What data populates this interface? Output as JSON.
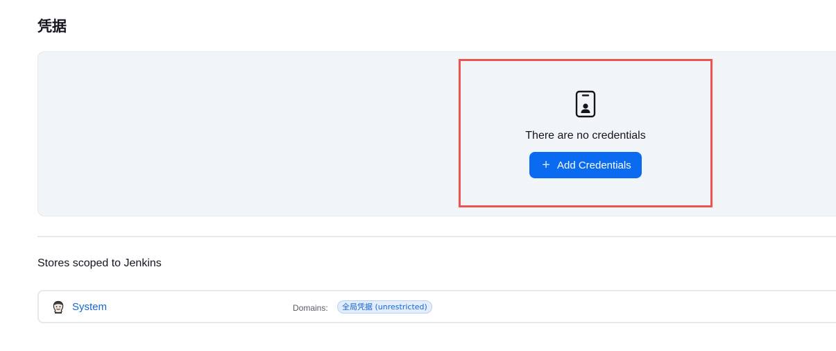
{
  "page": {
    "title": "凭据"
  },
  "empty_state": {
    "icon": "credential-card-icon",
    "message": "There are no credentials",
    "add_button": {
      "icon": "plus-icon",
      "label": "Add Credentials"
    }
  },
  "highlight": {
    "color": "#ef5350"
  },
  "stores": {
    "heading": "Stores scoped to Jenkins",
    "rows": [
      {
        "icon": "jenkins-icon",
        "name": "System",
        "domains_label": "Domains:",
        "domain_badge": "全局凭据 (unrestricted)"
      }
    ]
  },
  "colors": {
    "accent": "#0b6bf0",
    "link": "#1565d8",
    "panel_bg": "#f2f5f8"
  }
}
